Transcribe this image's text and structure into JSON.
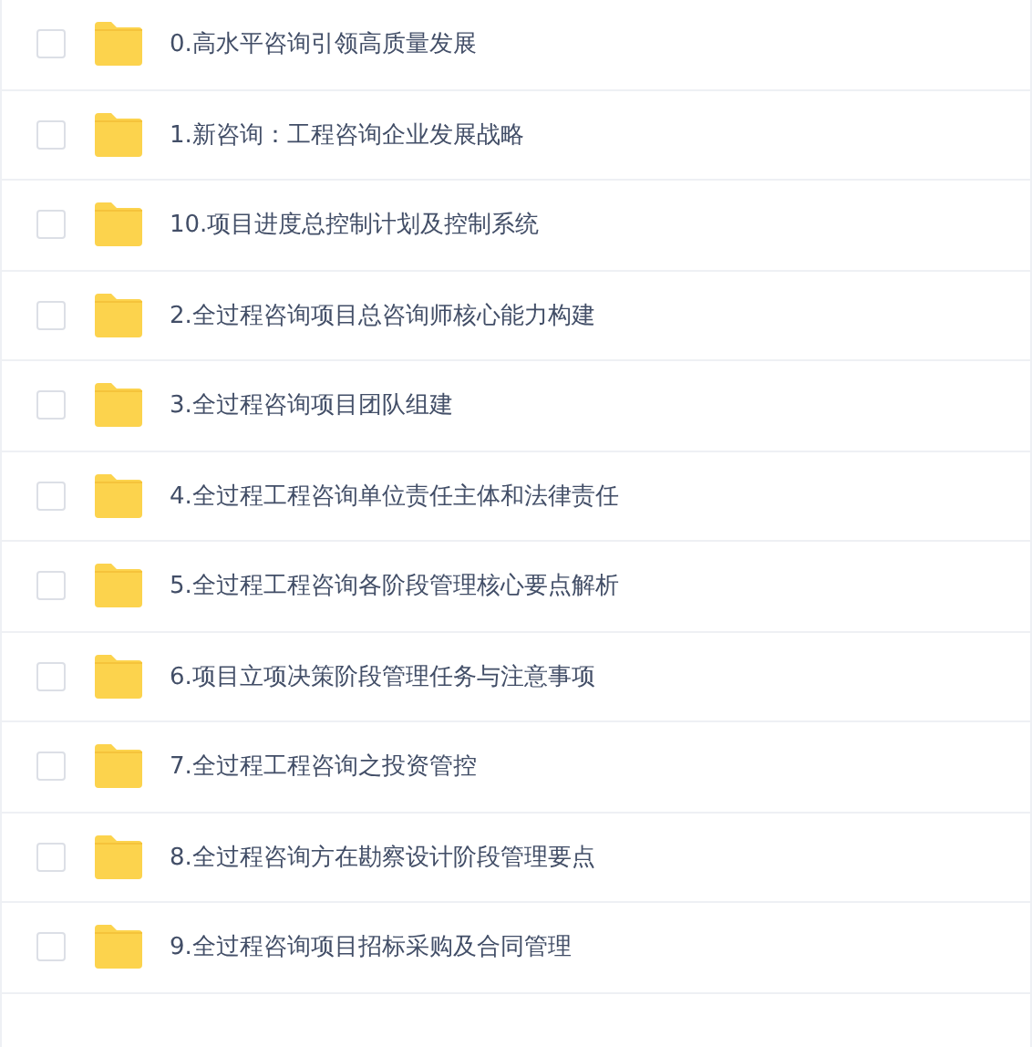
{
  "files": [
    {
      "name": "0.高水平咨询引领高质量发展",
      "checked": false
    },
    {
      "name": "1.新咨询：工程咨询企业发展战略",
      "checked": false
    },
    {
      "name": "10.项目进度总控制计划及控制系统",
      "checked": false
    },
    {
      "name": "2.全过程咨询项目总咨询师核心能力构建",
      "checked": false
    },
    {
      "name": "3.全过程咨询项目团队组建",
      "checked": false
    },
    {
      "name": "4.全过程工程咨询单位责任主体和法律责任",
      "checked": false
    },
    {
      "name": "5.全过程工程咨询各阶段管理核心要点解析",
      "checked": false
    },
    {
      "name": "6.项目立项决策阶段管理任务与注意事项",
      "checked": false
    },
    {
      "name": "7.全过程工程咨询之投资管控",
      "checked": false
    },
    {
      "name": "8.全过程咨询方在勘察设计阶段管理要点",
      "checked": false
    },
    {
      "name": "9.全过程咨询项目招标采购及合同管理",
      "checked": false
    }
  ]
}
